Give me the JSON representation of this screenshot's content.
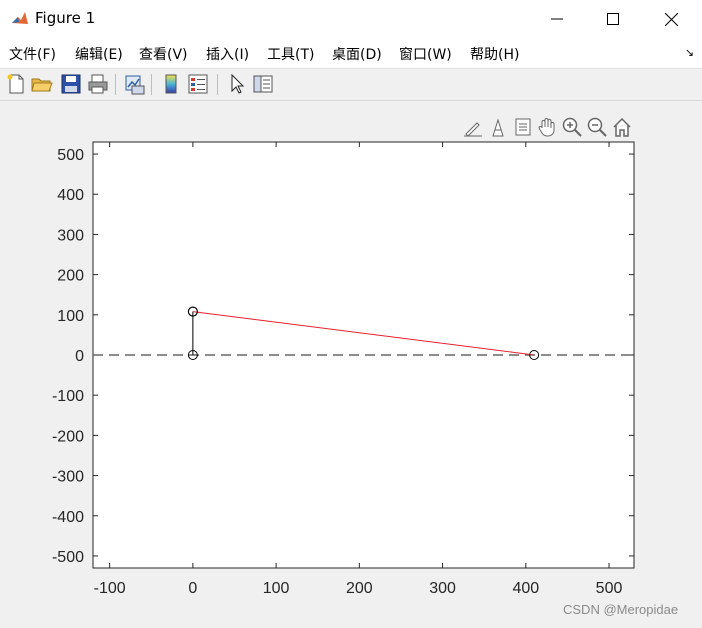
{
  "window": {
    "title": "Figure 1"
  },
  "menu": [
    "文件(F)",
    "编辑(E)",
    "查看(V)",
    "插入(I)",
    "工具(T)",
    "桌面(D)",
    "窗口(W)",
    "帮助(H)"
  ],
  "axes_toolbar_icons": [
    "brush-icon",
    "data-tip-icon",
    "legend-icon",
    "pan-icon",
    "zoom-in-icon",
    "zoom-out-icon",
    "home-icon"
  ],
  "toolbar_icons": [
    "new-figure-icon",
    "open-file-icon",
    "save-icon",
    "print-icon",
    "link-plot-icon",
    "colorbar-icon",
    "legend-insert-icon",
    "pointer-icon",
    "property-inspector-icon"
  ],
  "chart_data": {
    "type": "line",
    "xlim": [
      -120,
      530
    ],
    "ylim": [
      -530,
      530
    ],
    "xticks": [
      -100,
      0,
      100,
      200,
      300,
      400,
      500
    ],
    "yticks": [
      500,
      400,
      300,
      200,
      100,
      0,
      -100,
      -200,
      -300,
      -400,
      -500
    ],
    "grid": false,
    "series": [
      {
        "color": "#000000",
        "style": "solid",
        "marker": "circle",
        "x": [
          0,
          0
        ],
        "y": [
          0,
          108
        ]
      },
      {
        "color": "#e8202c",
        "style": "solid",
        "marker": "circle",
        "x": [
          0,
          410
        ],
        "y": [
          108,
          0
        ]
      },
      {
        "color": "#666666",
        "style": "dashed",
        "marker": "none",
        "x": [
          -120,
          530
        ],
        "y": [
          0,
          0
        ]
      }
    ]
  },
  "watermark": "CSDN @Meropidae"
}
